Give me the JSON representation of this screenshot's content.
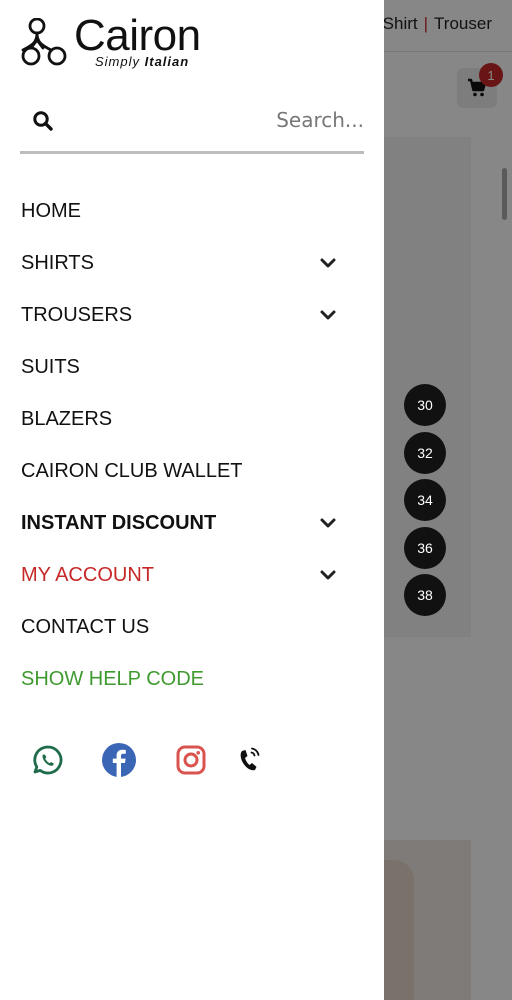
{
  "background": {
    "breadcrumb": {
      "item_a": "Shirt",
      "item_b": "Trouser",
      "separator": "|"
    },
    "cart_count": "1",
    "size_chips": [
      "30",
      "32",
      "34",
      "36",
      "38"
    ]
  },
  "drawer": {
    "logo": {
      "brand": "Cairon",
      "brand_tail": "n",
      "tagline_a": "Simply",
      "tagline_b": "Italian"
    },
    "search": {
      "placeholder": "Search..."
    },
    "menu": [
      {
        "label": "HOME"
      },
      {
        "label": "SHIRTS"
      },
      {
        "label": "TROUSERS"
      },
      {
        "label": "SUITS"
      },
      {
        "label": "BLAZERS"
      },
      {
        "label": "CAIRON CLUB WALLET"
      },
      {
        "label": "INSTANT DISCOUNT"
      },
      {
        "label": "MY ACCOUNT"
      },
      {
        "label": "CONTACT US"
      },
      {
        "label": "SHOW HELP CODE"
      }
    ],
    "social_icons": [
      "whatsapp-icon",
      "facebook-icon",
      "instagram-icon",
      "phone-icon"
    ]
  },
  "colors": {
    "accent_red": "#c62828",
    "accent_green": "#3f9a2f",
    "whatsapp": "#1f6b4a",
    "facebook": "#3b65b5",
    "instagram": "#d9534f"
  }
}
